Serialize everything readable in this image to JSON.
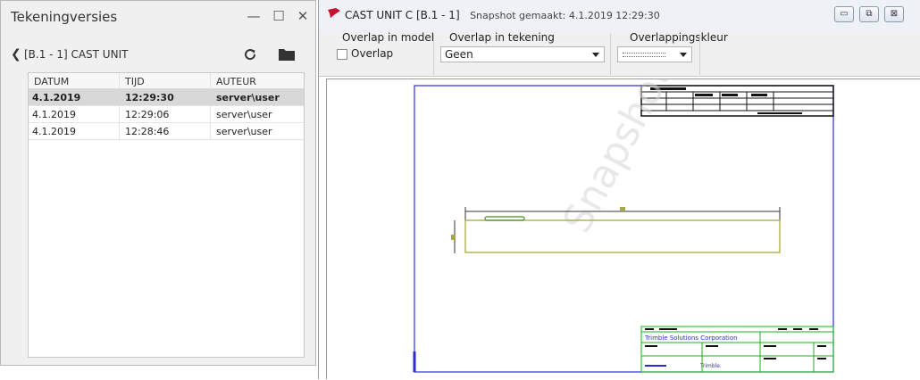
{
  "left_panel": {
    "title": "Tekeningversies",
    "controls": {
      "minimize": "—",
      "maximize": "☐",
      "close": "✕"
    },
    "breadcrumb": "[B.1 - 1] CAST UNIT",
    "table": {
      "headers": [
        "DATUM",
        "TIJD",
        "AUTEUR"
      ],
      "rows": [
        {
          "date": "4.1.2019",
          "time": "12:29:30",
          "author": "server\\user"
        },
        {
          "date": "4.1.2019",
          "time": "12:29:06",
          "author": "server\\user"
        },
        {
          "date": "4.1.2019",
          "time": "12:28:46",
          "author": "server\\user"
        }
      ]
    }
  },
  "right_window": {
    "title_main": "CAST UNIT C  [B.1 - 1]",
    "title_snapshot": "Snapshot gemaakt: 4.1.2019 12:29:30",
    "controls": {
      "minimize": "▭",
      "restore": "⧉",
      "close": "⊠"
    },
    "toolbar": {
      "overlap_model_label": "Overlap in model",
      "overlap_checkbox_label": "Overlap",
      "overlap_drawing_label": "Overlap in tekening",
      "overlap_drawing_value": "Geen",
      "overlap_color_label": "Overlappingskleur"
    },
    "drawing": {
      "watermark": "Snapshot",
      "title_block_company": "Trimble Solutions Corporation",
      "title_block_logo": "Trimble."
    }
  },
  "colors": {
    "drawing_border": "#2b2bd6",
    "title_block_line": "#19b219",
    "beam": "#a9a93c",
    "selected_row": "#d8d8d8",
    "app_icon": "#c8102e"
  }
}
